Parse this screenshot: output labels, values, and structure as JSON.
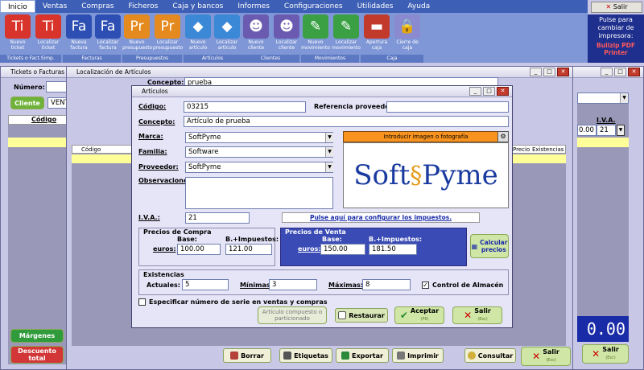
{
  "menu": [
    "Inicio",
    "Ventas",
    "Compras",
    "Ficheros",
    "Caja y bancos",
    "Informes",
    "Configuraciones",
    "Utilidades",
    "Ayuda"
  ],
  "ribbon": {
    "buttons": [
      {
        "glyph": "Ti",
        "label": "Nuevo ticket",
        "color": "#d9342b"
      },
      {
        "glyph": "Ti",
        "label": "Localizar ticket",
        "color": "#d9342b"
      },
      {
        "glyph": "Fa",
        "label": "Nueva factura",
        "color": "#2d4fb3"
      },
      {
        "glyph": "Fa",
        "label": "Localizar factura",
        "color": "#2d4fb3"
      },
      {
        "glyph": "Pr",
        "label": "Nuevo presupuesto",
        "color": "#e58a1e"
      },
      {
        "glyph": "Pr",
        "label": "Localizar presupuesto",
        "color": "#e58a1e"
      },
      {
        "glyph": "◆",
        "label": "Nuevo artículo",
        "color": "#3b88d6"
      },
      {
        "glyph": "◆",
        "label": "Localizar artículo",
        "color": "#3b88d6"
      },
      {
        "glyph": "☻",
        "label": "Nuevo cliente",
        "color": "#6a5bb0"
      },
      {
        "glyph": "☻",
        "label": "Localizar cliente",
        "color": "#6a5bb0"
      },
      {
        "glyph": "✎",
        "label": "Nuevo movimiento",
        "color": "#3aa043"
      },
      {
        "glyph": "✎",
        "label": "Localizar movimiento",
        "color": "#3aa043"
      },
      {
        "glyph": "▬",
        "label": "Apertura caja",
        "color": "#c23a2b"
      },
      {
        "glyph": "🔒",
        "label": "Cierre de caja",
        "color": "#8a8ad0"
      }
    ],
    "groups": [
      "Tickets o Fact.Simp.",
      "Facturas",
      "Presupuestos",
      "Artículos",
      "Clientes",
      "Movimientos",
      "Caja"
    ]
  },
  "exit_top": "Salir",
  "printer": {
    "text": "Pulse para cambiar de impresora:",
    "name": "Bullzip PDF Printer"
  },
  "tickets_window": {
    "title": "Tickets o Facturas",
    "numero_label": "Número:",
    "cliente_button": "Cliente",
    "cliente_value": "VENT",
    "codigo_header": "Código",
    "margenes": "Márgenes",
    "descuento": "Descuento total",
    "right_cols": {
      "l": "l",
      "iva": "I.V.A.",
      "val": "0.00",
      "iva_val": "21"
    },
    "total": "0.00",
    "salir": "Salir",
    "salir_sub": "(Esc)"
  },
  "localizacion_window": {
    "title": "Localización de Artículos",
    "concepto_label": "Concepto:",
    "concepto_value": "prueba",
    "cols": [
      "Código",
      "Precio",
      "Existencias"
    ],
    "footer": {
      "borrar": "Borrar",
      "etiquetas": "Etiquetas",
      "exportar": "Exportar",
      "imprimir": "Imprimir",
      "consultar": "Consultar",
      "salir": "Salir",
      "salir_sub": "(Esc)"
    }
  },
  "articulos": {
    "title": "Artículos",
    "codigo_label": "Código:",
    "codigo_value": "03215",
    "ref_label": "Referencia proveedor:",
    "ref_value": "",
    "concepto_label": "Concepto:",
    "concepto_value": "Artículo de prueba",
    "marca_label": "Marca:",
    "marca_value": "SoftPyme",
    "familia_label": "Familia:",
    "familia_value": "Software",
    "proveedor_label": "Proveedor:",
    "proveedor_value": "SoftPyme",
    "obs_label": "Observaciones:",
    "obs_value": "",
    "image_button": "Introducir imagen o fotografía",
    "logo_text_a": "Soft",
    "logo_text_b": "Pyme",
    "iva_label": "I.V.A.:",
    "iva_value": "21",
    "impuestos_link": "Pulse aquí para configurar los impuestos.",
    "compra": {
      "title": "Precios de Compra",
      "base_label": "Base:",
      "imp_label": "B.+Impuestos:",
      "euros": "euros:",
      "base": "100.00",
      "imp": "121.00"
    },
    "venta": {
      "title": "Precios de Venta",
      "base_label": "Base:",
      "imp_label": "B.+Impuestos:",
      "euros": "euros:",
      "base": "150.00",
      "imp": "181.50"
    },
    "calcular": "Calcular precios",
    "exist": {
      "title": "Existencias",
      "actuales_label": "Actuales:",
      "actuales": "5",
      "minimas_label": "Mínimas:",
      "minimas": "3",
      "maximas_label": "Máximas:",
      "maximas": "8",
      "control": "Control de Almacén"
    },
    "serie": "Especificar número de serie en ventas y compras",
    "compuesto": "Artículo compuesto o particionado",
    "restaurar": "Restaurar",
    "aceptar": "Aceptar",
    "aceptar_sub": "(F6)",
    "salir": "Salir",
    "salir_sub": "(Esc)"
  }
}
